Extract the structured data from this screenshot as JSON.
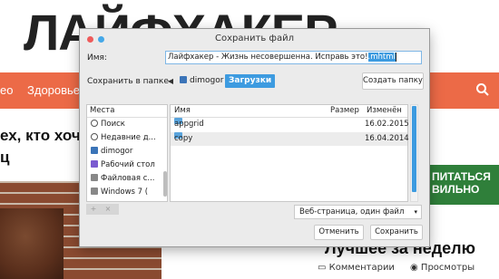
{
  "background": {
    "logo": "ЛАЙФХАКЕР",
    "nav_items": [
      "ео",
      "Здоровье",
      "Д"
    ],
    "headline_lines": [
      "ех, кто хоче",
      "ц"
    ],
    "green_banner_lines": [
      "ПИТАТЬСЯ",
      "ВИЛЬНО"
    ],
    "best_title": "Лучшее за неделю",
    "meta_comments": "Комментарии",
    "meta_views": "Просмотры"
  },
  "dialog": {
    "title": "Сохранить файл",
    "name_label": "Имя:",
    "name_value_plain": "Лайфхакер - Жизнь несовершенна. Исправь это!",
    "name_value_selected": ".mhtml",
    "folder_label": "Сохранить в папке",
    "breadcrumbs": [
      "dimogor",
      "Загрузки"
    ],
    "create_folder": "Создать папку",
    "places": {
      "header": "Места",
      "items": [
        {
          "label": "Поиск",
          "icon": "search-icon"
        },
        {
          "label": "Недавние д...",
          "icon": "recent-icon"
        },
        {
          "label": "dimogor",
          "icon": "home-icon"
        },
        {
          "label": "Рабочий стол",
          "icon": "desktop-icon"
        },
        {
          "label": "Файловая с...",
          "icon": "filesystem-icon"
        },
        {
          "label": "Windows 7 (",
          "icon": "drive-icon"
        }
      ],
      "tools": [
        "+",
        "×"
      ]
    },
    "files": {
      "columns": [
        "Имя",
        "Размер",
        "Изменён"
      ],
      "rows": [
        {
          "name": "appgrid",
          "size": "",
          "modified": "16.02.2015"
        },
        {
          "name": "copy",
          "size": "",
          "modified": "16.04.2014"
        }
      ]
    },
    "filter": "Веб-страница, один файл",
    "cancel": "Отменить",
    "save": "Сохранить",
    "colors": {
      "accent": "#3d9be0",
      "dialog_bg": "#ebebeb",
      "nav": "#ec6a47"
    }
  }
}
